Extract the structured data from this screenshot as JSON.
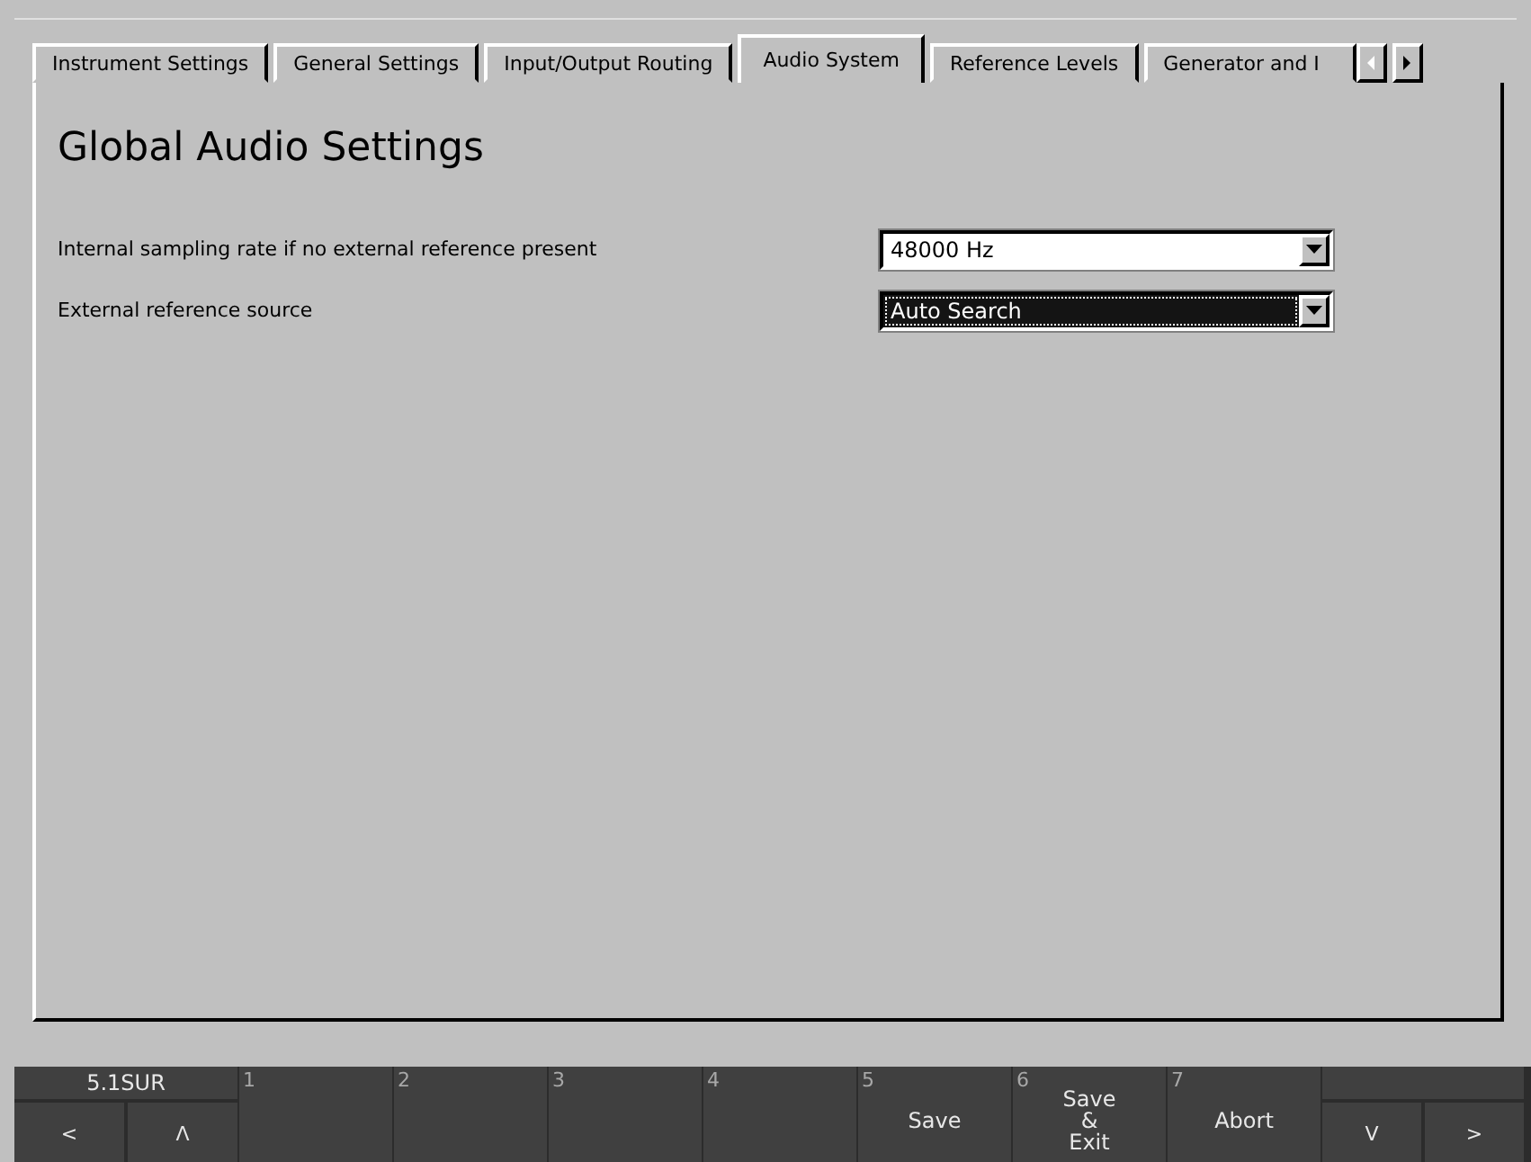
{
  "tabs": [
    {
      "label": "Instrument Settings",
      "selected": false
    },
    {
      "label": "General Settings",
      "selected": false
    },
    {
      "label": "Input/Output Routing",
      "selected": false
    },
    {
      "label": "Audio System",
      "selected": true
    },
    {
      "label": "Reference Levels",
      "selected": false
    },
    {
      "label": "Generator and I",
      "selected": false
    }
  ],
  "tab_scroll": {
    "left_disabled": true,
    "right_disabled": false
  },
  "heading": "Global Audio Settings",
  "settings": [
    {
      "label": "Internal sampling rate if no external reference present",
      "value": "48000 Hz",
      "focused": false
    },
    {
      "label": "External reference source",
      "value": "Auto Search",
      "focused": true
    }
  ],
  "bottom_bar": {
    "mode": "5.1SUR",
    "left_keys": [
      "<",
      "Λ"
    ],
    "softkeys": [
      {
        "number": "1"
      },
      {
        "number": "2"
      },
      {
        "number": "3"
      },
      {
        "number": "4"
      },
      {
        "number": "5",
        "label": [
          "Save"
        ]
      },
      {
        "number": "6",
        "label": [
          "Save",
          "&",
          "Exit"
        ]
      },
      {
        "number": "7",
        "label": [
          "Abort"
        ]
      }
    ],
    "right_keys": [
      "V",
      ">"
    ]
  }
}
